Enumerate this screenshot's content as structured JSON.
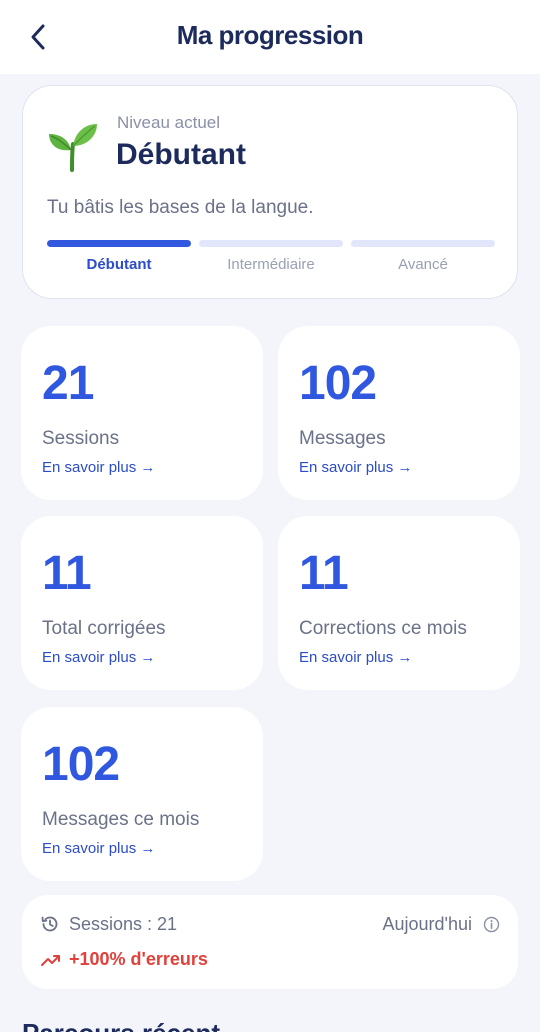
{
  "header": {
    "title": "Ma progression",
    "back_icon": "chevron-left-icon"
  },
  "level": {
    "caption": "Niveau actuel",
    "name": "Débutant",
    "description": "Tu bâtis les bases de la langue.",
    "icon": "sprout-icon",
    "segments": [
      {
        "label": "Débutant",
        "active": true
      },
      {
        "label": "Intermédiaire",
        "active": false
      },
      {
        "label": "Avancé",
        "active": false
      }
    ]
  },
  "stats": [
    {
      "value": "21",
      "label": "Sessions",
      "link": "En savoir plus →"
    },
    {
      "value": "102",
      "label": "Messages",
      "link": "En savoir plus →"
    },
    {
      "value": "11",
      "label": "Total corrigées",
      "link": "En savoir plus →"
    },
    {
      "value": "11",
      "label": "Corrections ce mois",
      "link": "En savoir plus →"
    },
    {
      "value": "102",
      "label": "Messages ce mois",
      "link": "En savoir plus →"
    }
  ],
  "summary": {
    "sessions": "Sessions : 21",
    "period": "Aujourd'hui",
    "trend": "+100% d'erreurs"
  },
  "next_section": {
    "title": "Parcours récent"
  },
  "colors": {
    "accent": "#3057e0",
    "title": "#1d2b5c",
    "error": "#e0413b",
    "background": "#f3f5fb"
  }
}
